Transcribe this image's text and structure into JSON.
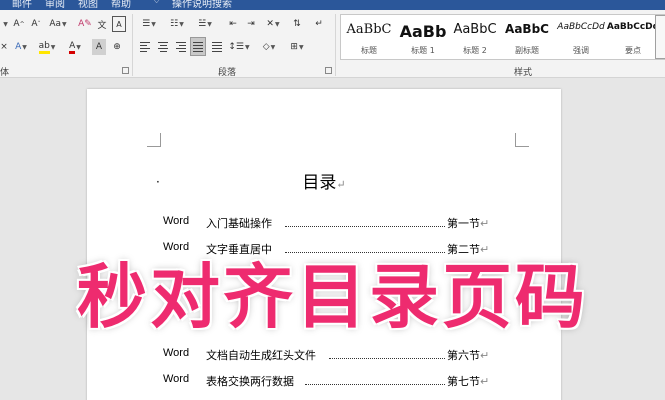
{
  "tabs": [
    "邮件",
    "审阅",
    "视图",
    "帮助",
    "操作说明搜索"
  ],
  "ribbon": {
    "groups": {
      "font": "体",
      "paragraph": "段落",
      "styles": "样式"
    },
    "styles": [
      {
        "sample": "AaBbC",
        "name": "标题"
      },
      {
        "sample": "AaBb",
        "name": "标题 1"
      },
      {
        "sample": "AaBbC",
        "name": "标题 2"
      },
      {
        "sample": "AaBbC",
        "name": "副标题"
      },
      {
        "sample": "AaBbCcDd",
        "name": "强调"
      },
      {
        "sample": "AaBbCcDd",
        "name": "要点"
      }
    ]
  },
  "document": {
    "title": "目录",
    "mark": "↵",
    "toc": [
      {
        "prefix": "Word",
        "text": "入门基础操作",
        "section": "第一节"
      },
      {
        "prefix": "Word",
        "text": "文字垂直居中",
        "section": "第二节"
      },
      {
        "prefix": "Word",
        "text": "文档自动生成红头文件",
        "section": "第六节"
      },
      {
        "prefix": "Word",
        "text": "表格交换两行数据",
        "section": "第七节"
      }
    ]
  },
  "overlay_text": "秒对齐目录页码",
  "colors": {
    "title_bar": "#2b579a",
    "overlay": "#ee2b6f"
  }
}
